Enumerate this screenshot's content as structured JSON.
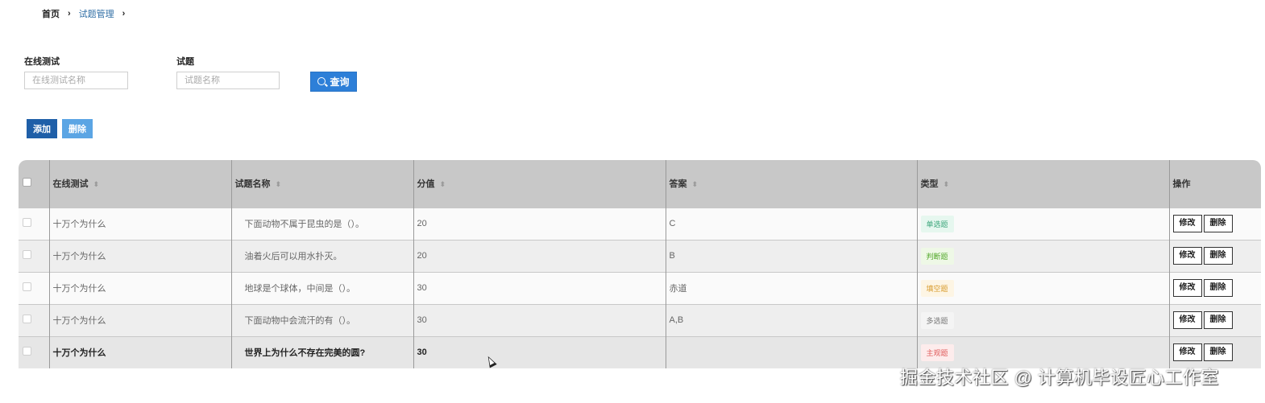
{
  "breadcrumb": {
    "home": "首页",
    "current": "试题管理"
  },
  "search": {
    "test_label": "在线测试",
    "test_placeholder": "在线测试名称",
    "question_label": "试题",
    "question_placeholder": "试题名称",
    "query_label": "查询"
  },
  "actions": {
    "add_label": "添加",
    "delete_label": "删除"
  },
  "table": {
    "headers": [
      "在线测试",
      "试题名称",
      "分值",
      "答案",
      "类型",
      "操作"
    ],
    "rows": [
      {
        "test": "十万个为什么",
        "question": "下面动物不属于昆虫的是（）。",
        "score": "20",
        "answer": "C",
        "type": "单选题",
        "type_color": "#3aa57a",
        "type_bg": "#e6f7ef"
      },
      {
        "test": "十万个为什么",
        "question": "油着火后可以用水扑灭。",
        "score": "20",
        "answer": "B",
        "type": "判断题",
        "type_color": "#52a82a",
        "type_bg": "#eef8e6"
      },
      {
        "test": "十万个为什么",
        "question": "地球是个球体，中间是（）。",
        "score": "30",
        "answer": "赤道",
        "type": "填空题",
        "type_color": "#d89a2a",
        "type_bg": "#fdf5e4"
      },
      {
        "test": "十万个为什么",
        "question": "下面动物中会流汗的有（）。",
        "score": "30",
        "answer": "A,B",
        "type": "多选题",
        "type_color": "#777777",
        "type_bg": "#f4f4f4"
      },
      {
        "test": "十万个为什么",
        "question": "世界上为什么不存在完美的圆?",
        "score": "30",
        "answer": "",
        "type": "主观题",
        "type_color": "#e05a5a",
        "type_bg": "#fdecec"
      }
    ],
    "edit_label": "修改",
    "delete_label": "删除"
  },
  "watermark": "掘金技术社区 @ 计算机毕设匠心工作室"
}
